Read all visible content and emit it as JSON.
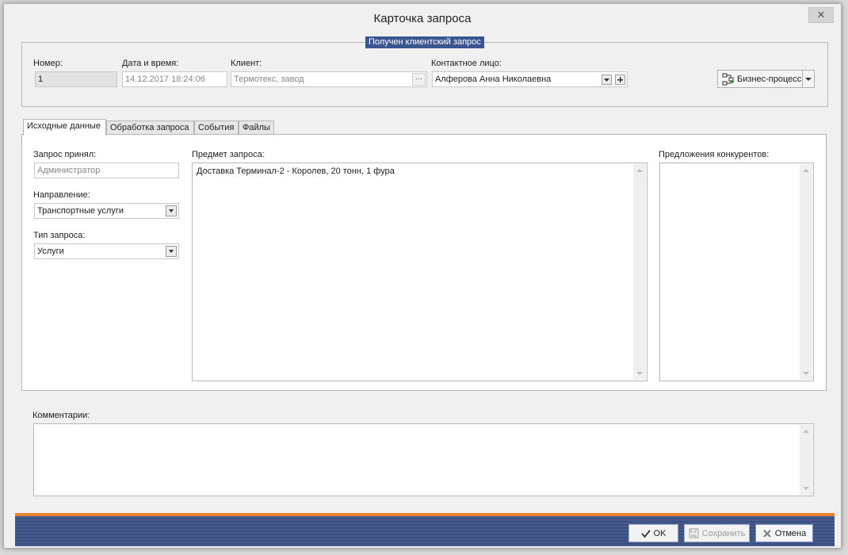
{
  "window": {
    "title": "Карточка запроса",
    "close_icon": "✕"
  },
  "group": {
    "caption": "Получен клиентский запрос",
    "number_label": "Номер:",
    "number_value": "1",
    "datetime_label": "Дата и время:",
    "datetime_value": "14.12.2017 18:24:06",
    "client_label": "Клиент:",
    "client_value": "Термотекс, завод",
    "contact_label": "Контактное лицо:",
    "contact_value": "Алферова Анна Николаевна",
    "business_process_label": "Бизнес-процесс"
  },
  "tabs": [
    {
      "label": "Исходные данные",
      "active": true
    },
    {
      "label": "Обработка запроса",
      "active": false
    },
    {
      "label": "События",
      "active": false
    },
    {
      "label": "Файлы",
      "active": false
    }
  ],
  "source_tab": {
    "accepted_label": "Запрос принял:",
    "accepted_value": "Администратор",
    "direction_label": "Направление:",
    "direction_value": "Транспортные услуги",
    "request_type_label": "Тип запроса:",
    "request_type_value": "Услуги",
    "subject_label": "Предмет запроса:",
    "subject_value": "Доставка Терминал-2 - Королев, 20 тонн, 1 фура",
    "competitors_label": "Предложения конкурентов:",
    "competitors_value": ""
  },
  "comments": {
    "label": "Комментарии:",
    "value": ""
  },
  "footer": {
    "ok_label": "OK",
    "save_label": "Сохранить",
    "cancel_label": "Отмена"
  },
  "colors": {
    "accent_orange": "#e9852f",
    "footer_blue": "#465c8f",
    "caption_blue": "#3b5590"
  }
}
